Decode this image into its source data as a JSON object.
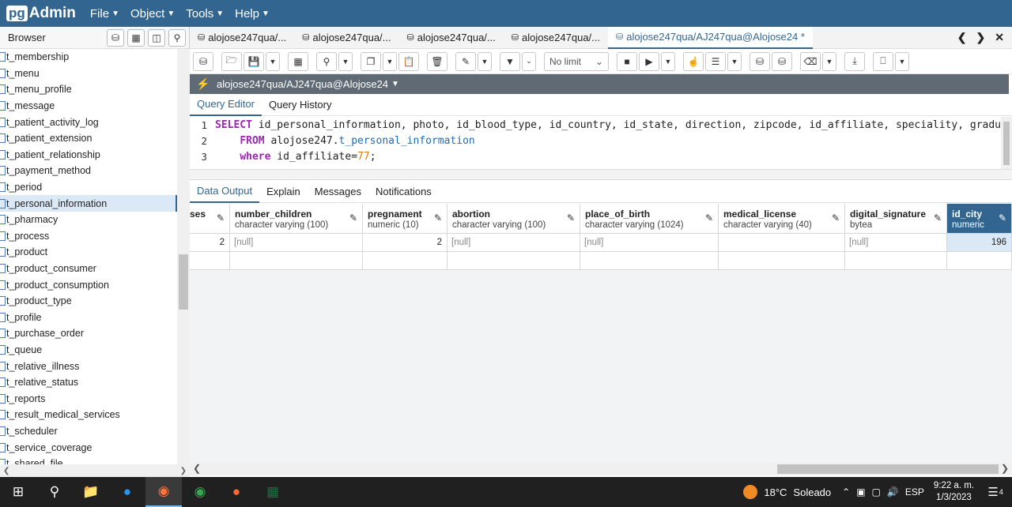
{
  "app": {
    "logo_pg": "pg",
    "logo_admin": "Admin",
    "menus": [
      "File",
      "Object",
      "Tools",
      "Help"
    ]
  },
  "browser": {
    "title": "Browser",
    "items": [
      "t_membership",
      "t_menu",
      "t_menu_profile",
      "t_message",
      "t_patient_activity_log",
      "t_patient_extension",
      "t_patient_relationship",
      "t_payment_method",
      "t_period",
      "t_personal_information",
      "t_pharmacy",
      "t_process",
      "t_product",
      "t_product_consumer",
      "t_product_consumption",
      "t_product_type",
      "t_profile",
      "t_purchase_order",
      "t_queue",
      "t_relative_illness",
      "t_relative_status",
      "t_reports",
      "t_result_medical_services",
      "t_scheduler",
      "t_service_coverage",
      "t_shared_file"
    ],
    "selected_index": 9
  },
  "tabs": [
    "alojose247qua/...",
    "alojose247qua/...",
    "alojose247qua/...",
    "alojose247qua/...",
    "alojose247qua/AJ247qua@Alojose24 *"
  ],
  "toolbar": {
    "limit": "No limit"
  },
  "connection": {
    "label": "alojose247qua/AJ247qua@Alojose24"
  },
  "editor_tabs": [
    "Query Editor",
    "Query History"
  ],
  "editor": {
    "line_numbers": [
      "1",
      "2",
      "3"
    ],
    "line1_kw": "SELECT",
    "line1_rest": " id_personal_information, photo, id_blood_type, id_country, id_state, direction, zipcode, id_affiliate, speciality, gradu",
    "line2_kw": "FROM",
    "line2_schema": " alojose247.",
    "line2_table": "t_personal_information",
    "line3_kw": "where",
    "line3_rest": " id_affiliate=",
    "line3_num": "77",
    "line3_end": ";"
  },
  "output_tabs": [
    "Data Output",
    "Explain",
    "Messages",
    "Notifications"
  ],
  "grid": {
    "partial_col": "ses",
    "columns": [
      {
        "name": "number_children",
        "type": "character varying (100)"
      },
      {
        "name": "pregnament",
        "type": "numeric (10)"
      },
      {
        "name": "abortion",
        "type": "character varying (100)"
      },
      {
        "name": "place_of_birth",
        "type": "character varying (1024)"
      },
      {
        "name": "medical_license",
        "type": "character varying (40)"
      },
      {
        "name": "digital_signature",
        "type": "bytea"
      },
      {
        "name": "id_city",
        "type": "numeric"
      }
    ],
    "row": {
      "partial": "2",
      "values": [
        "[null]",
        "2",
        "[null]",
        "[null]",
        "",
        "[null]",
        "196"
      ]
    }
  },
  "taskbar": {
    "weather_temp": "18°C",
    "weather_text": "Soleado",
    "lang": "ESP",
    "time": "9:22 a. m.",
    "date": "1/3/2023",
    "notif_count": "4"
  }
}
